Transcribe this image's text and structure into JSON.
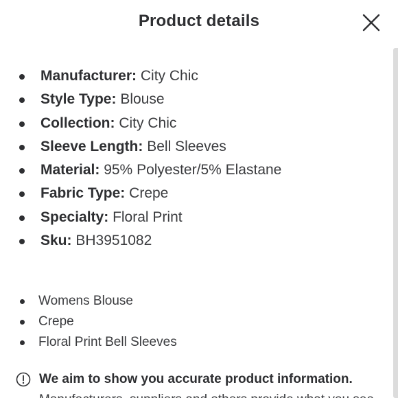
{
  "header": {
    "title": "Product details",
    "close_icon": "close-icon"
  },
  "specs": [
    {
      "key": "Manufacturer:",
      "value": "City Chic"
    },
    {
      "key": "Style Type:",
      "value": "Blouse"
    },
    {
      "key": "Collection:",
      "value": "City Chic"
    },
    {
      "key": "Sleeve Length:",
      "value": "Bell Sleeves"
    },
    {
      "key": "Material:",
      "value": "95% Polyester/5% Elastane"
    },
    {
      "key": "Fabric Type:",
      "value": "Crepe"
    },
    {
      "key": "Specialty:",
      "value": "Floral Print"
    },
    {
      "key": "Sku:",
      "value": "BH3951082"
    }
  ],
  "highlights": [
    "Womens Blouse",
    "Crepe",
    "Floral Print Bell Sleeves"
  ],
  "notice": {
    "icon": "info-icon",
    "headline": "We aim to show you accurate product information.",
    "body": "Manufacturers, suppliers and others provide what you see"
  }
}
